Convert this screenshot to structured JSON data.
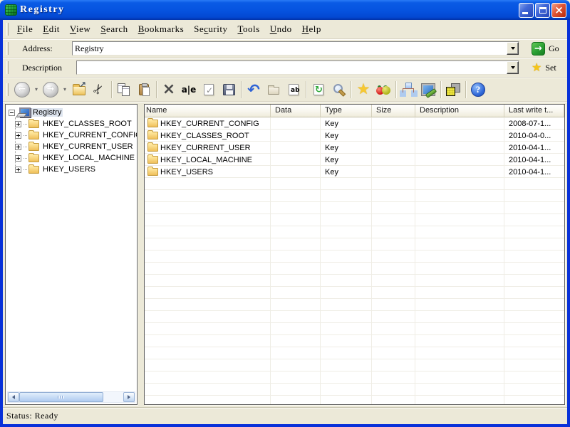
{
  "window": {
    "title": "Registry"
  },
  "colors": {
    "titlebar_blue": "#0A5BE5",
    "window_border_blue": "#0831D9",
    "chrome_beige": "#ECE9D8",
    "go_green": "#2BA033",
    "star_gold": "#F5C518",
    "folder_yellow": "#EFC05A",
    "tree_selection": "#DEE5EF"
  },
  "menu": {
    "items": [
      {
        "label": "File",
        "pre": "",
        "mn": "F",
        "post": "ile"
      },
      {
        "label": "Edit",
        "pre": "",
        "mn": "E",
        "post": "dit"
      },
      {
        "label": "View",
        "pre": "",
        "mn": "V",
        "post": "iew"
      },
      {
        "label": "Search",
        "pre": "",
        "mn": "S",
        "post": "earch"
      },
      {
        "label": "Bookmarks",
        "pre": "",
        "mn": "B",
        "post": "ookmarks"
      },
      {
        "label": "Security",
        "pre": "Se",
        "mn": "c",
        "post": "urity"
      },
      {
        "label": "Tools",
        "pre": "",
        "mn": "T",
        "post": "ools"
      },
      {
        "label": "Undo",
        "pre": "",
        "mn": "U",
        "post": "ndo"
      },
      {
        "label": "Help",
        "pre": "",
        "mn": "H",
        "post": "elp"
      }
    ]
  },
  "addressbar": {
    "label": "Address:",
    "value": "Registry",
    "go_label": "Go"
  },
  "descriptionbar": {
    "label": "Description",
    "value": "",
    "set_label": "Set"
  },
  "toolbar": {
    "buttons": [
      "back",
      "back-dropdown",
      "forward",
      "forward-dropdown",
      "parent-key",
      "cut",
      "copy",
      "paste",
      "delete",
      "rename",
      "apply",
      "save",
      "undo",
      "new-key",
      "new-value",
      "refresh",
      "find",
      "add-bookmark",
      "bookmarks",
      "remote-registry",
      "permissions",
      "compare",
      "help"
    ]
  },
  "tree": {
    "root": "Registry",
    "items": [
      "HKEY_CLASSES_ROOT",
      "HKEY_CURRENT_CONFIG",
      "HKEY_CURRENT_USER",
      "HKEY_LOCAL_MACHINE",
      "HKEY_USERS"
    ]
  },
  "list": {
    "columns": [
      "Name",
      "Data",
      "Type",
      "Size",
      "Description",
      "Last write t..."
    ],
    "rows": [
      {
        "name": "HKEY_CURRENT_CONFIG",
        "data": "",
        "type": "Key",
        "size": "",
        "description": "",
        "last_write": "2008-07-1..."
      },
      {
        "name": "HKEY_CLASSES_ROOT",
        "data": "",
        "type": "Key",
        "size": "",
        "description": "",
        "last_write": "2010-04-0..."
      },
      {
        "name": "HKEY_CURRENT_USER",
        "data": "",
        "type": "Key",
        "size": "",
        "description": "",
        "last_write": "2010-04-1..."
      },
      {
        "name": "HKEY_LOCAL_MACHINE",
        "data": "",
        "type": "Key",
        "size": "",
        "description": "",
        "last_write": "2010-04-1..."
      },
      {
        "name": "HKEY_USERS",
        "data": "",
        "type": "Key",
        "size": "",
        "description": "",
        "last_write": "2010-04-1..."
      }
    ]
  },
  "statusbar": {
    "text": "Status: Ready"
  }
}
